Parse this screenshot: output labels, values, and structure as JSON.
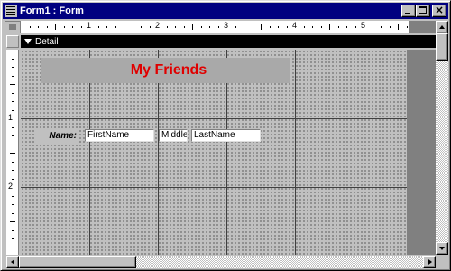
{
  "window": {
    "title": "Form1 : Form",
    "buttons": [
      "minimize",
      "maximize",
      "close"
    ]
  },
  "ruler": {
    "horizontal_numbers": [
      "1",
      "2",
      "3",
      "4",
      "5"
    ],
    "vertical_numbers": [
      "1",
      "2"
    ]
  },
  "section": {
    "label": "Detail"
  },
  "form": {
    "title_label": "My Friends",
    "title_color": "#e00000",
    "name_label": "Name:",
    "fields": {
      "first": "FirstName",
      "middle": "Middle",
      "last": "LastName"
    }
  },
  "colors": {
    "titlebar": "#000080",
    "face": "#c0c0c0",
    "section_bar": "#000000",
    "title_label_bg": "#a9a9a9"
  },
  "icons": {
    "window": "form-icon",
    "section": "section-arrow-icon"
  }
}
